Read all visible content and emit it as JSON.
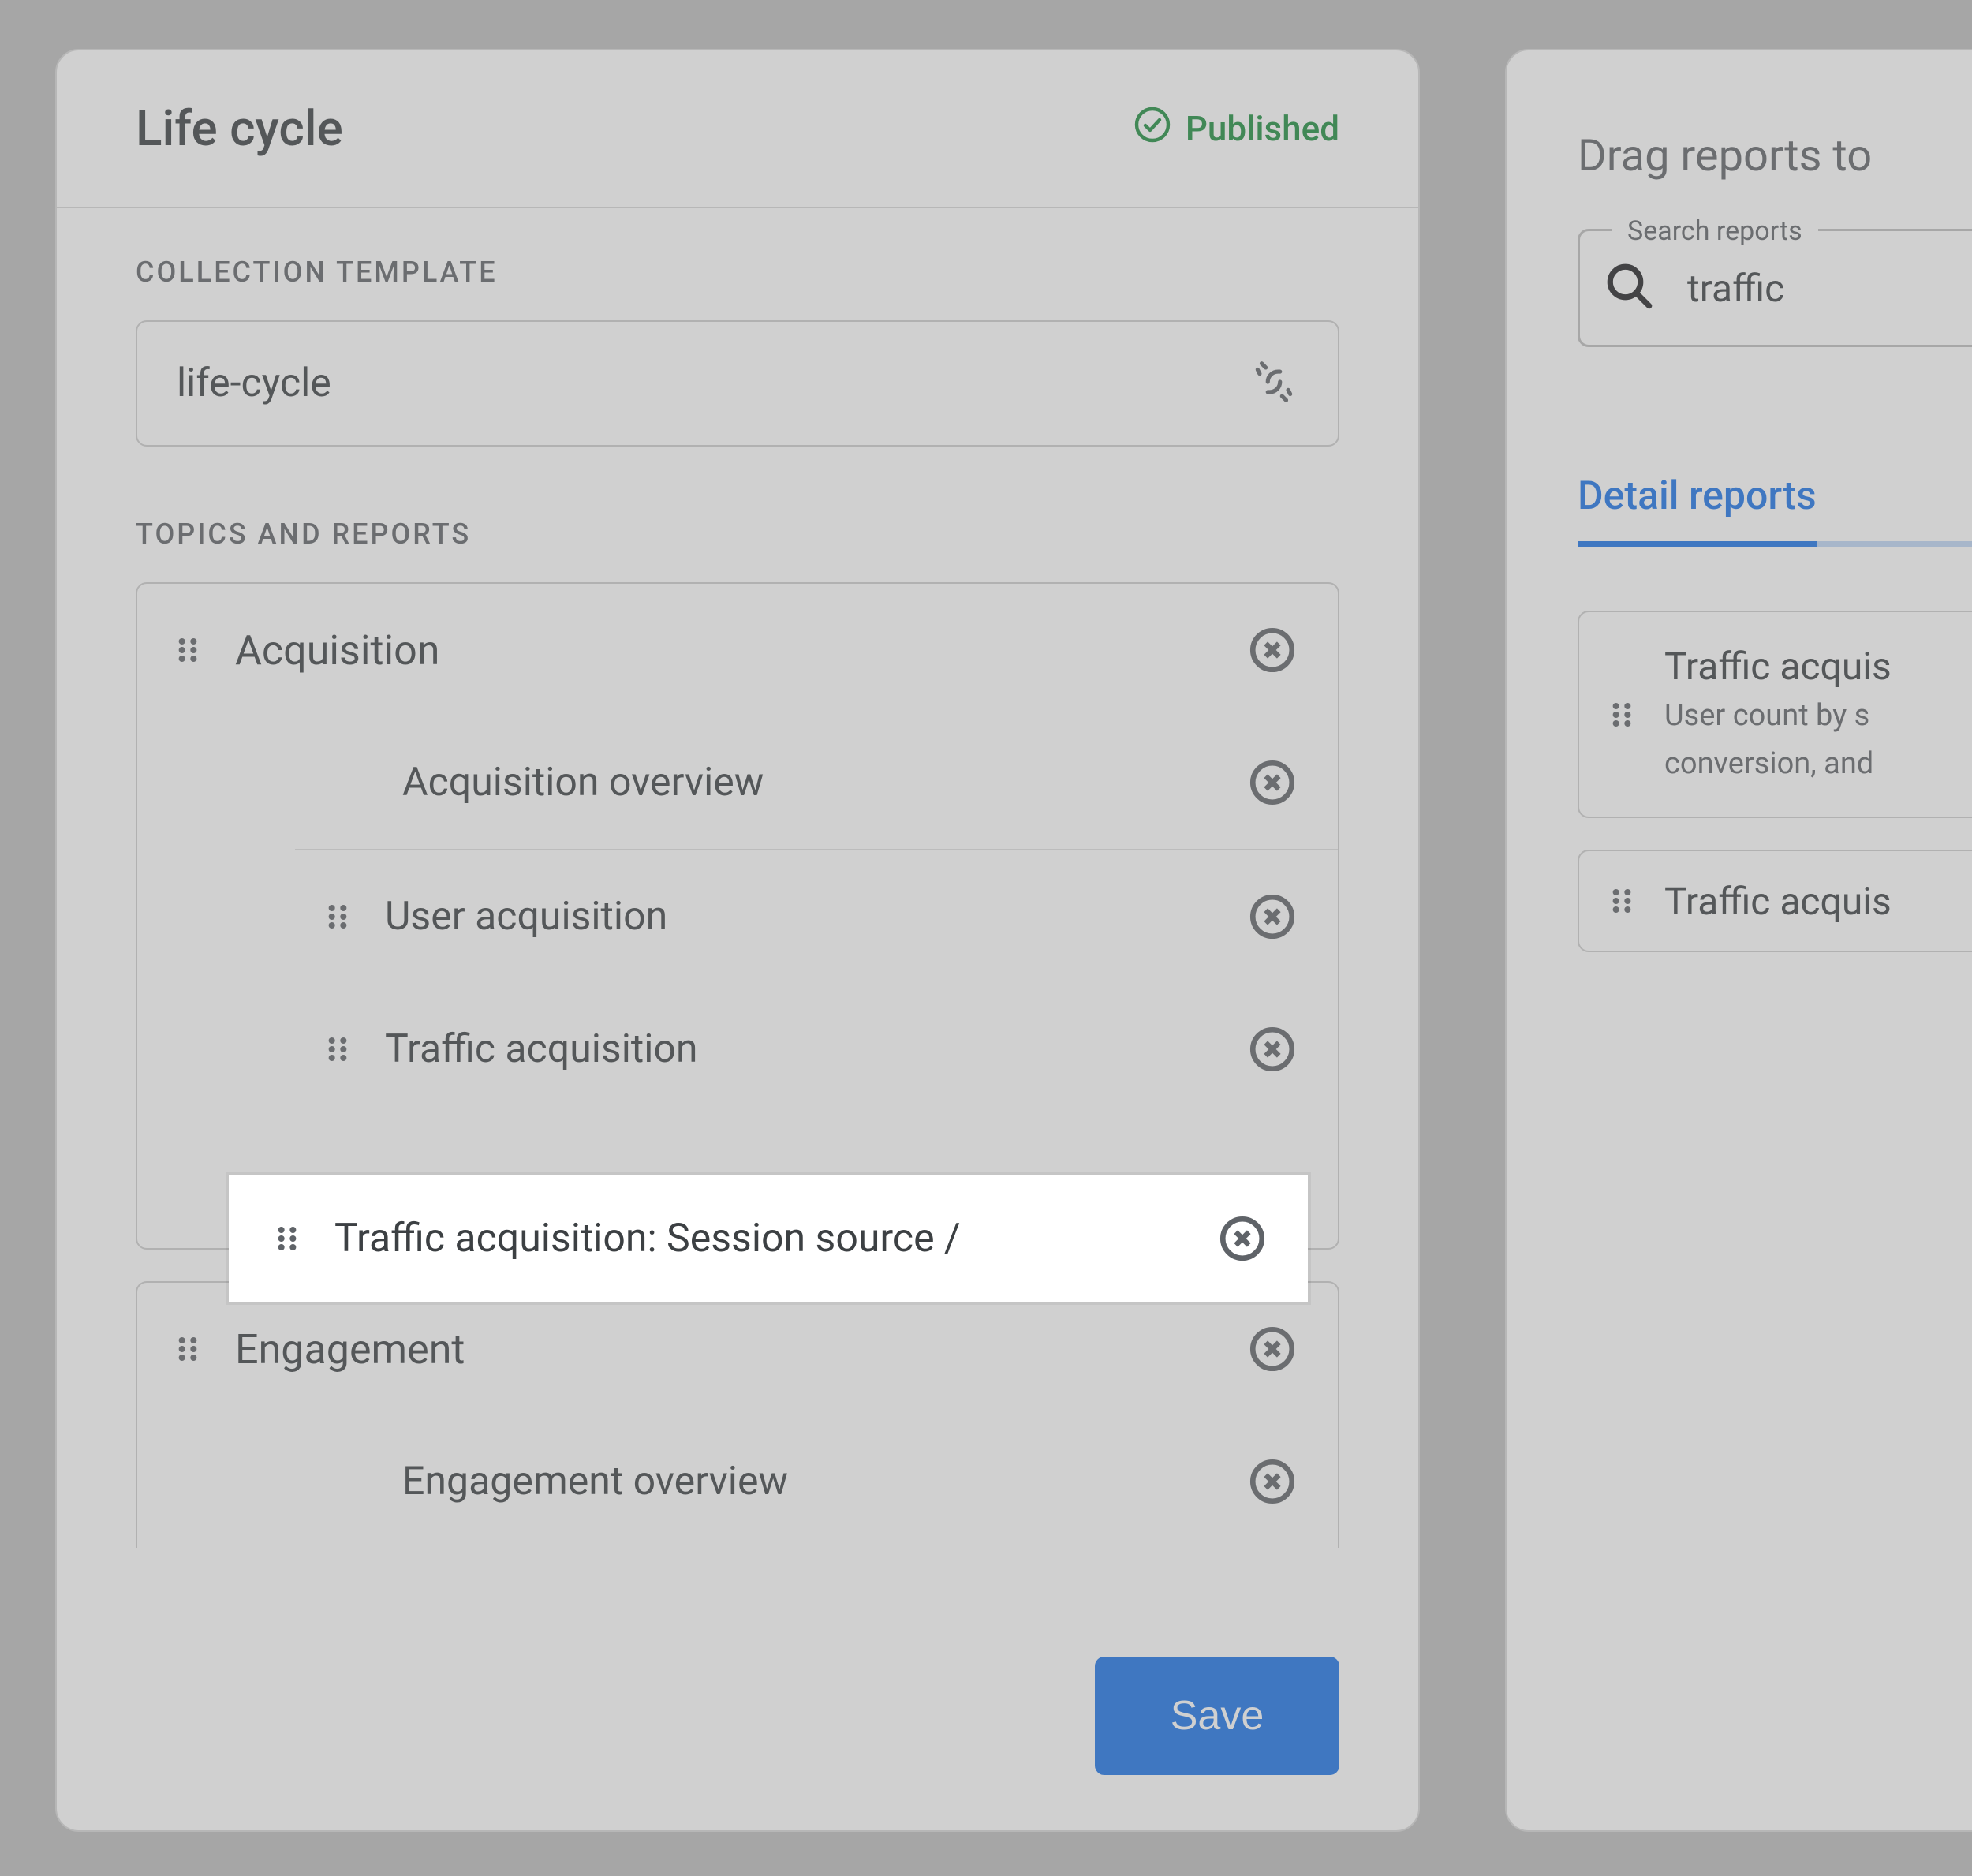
{
  "header": {
    "title": "Life cycle",
    "status": "Published"
  },
  "template": {
    "section_label": "COLLECTION TEMPLATE",
    "value": "life-cycle"
  },
  "topics_label": "TOPICS AND REPORTS",
  "topics": [
    {
      "name": "Acquisition",
      "reports": [
        {
          "label": "Acquisition overview",
          "has_drag": false
        },
        {
          "label": "User acquisition",
          "has_drag": true
        },
        {
          "label": "Traffic acquisition",
          "has_drag": true
        },
        {
          "label": "Traffic acquisition: Session source /",
          "has_drag": true,
          "highlight": true
        }
      ]
    },
    {
      "name": "Engagement",
      "reports": [
        {
          "label": "Engagement overview",
          "has_drag": false
        }
      ]
    }
  ],
  "save_label": "Save",
  "right": {
    "title": "Drag reports to",
    "search_label": "Search reports",
    "search_value": "traffic",
    "tab": "Detail reports",
    "results": [
      {
        "title": "Traffic acquis",
        "desc1": "User count by s",
        "desc2": "conversion, and"
      },
      {
        "title": "Traffic acquis"
      }
    ]
  }
}
